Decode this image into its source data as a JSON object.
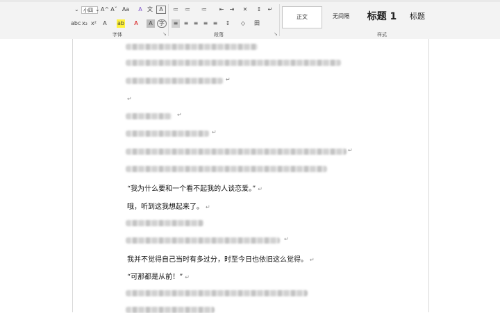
{
  "ribbon": {
    "font_size_value": "小四",
    "groups": {
      "font": "字体",
      "paragraph": "段落",
      "styles": "样式"
    },
    "style_gallery": [
      "正文",
      "无间隔",
      "标题 1",
      "标题"
    ],
    "symbols": {
      "grow_font": "A^",
      "shrink_font": "Aˇ",
      "change_case": "Aa",
      "clear_format": "A",
      "phonetic": "文",
      "char_border": "A",
      "strike": "abc",
      "subscript": "x₂",
      "superscript": "x²",
      "text_effects": "A",
      "highlight": "ab",
      "font_color": "A",
      "char_shading": "A",
      "enclosed": "字",
      "bullets": "≔",
      "numbering": "≔",
      "multilevel": "≔",
      "decrease_indent": "⇤",
      "increase_indent": "⇥",
      "sort": "↕",
      "show_marks": "↵",
      "asian_layout": "✕",
      "align_left": "≡",
      "center": "≡",
      "align_right": "≡",
      "justify": "≡",
      "distributed": "≡",
      "line_spacing": "↕",
      "shading": "◇",
      "borders": "田",
      "dialog_launcher": "↘"
    }
  },
  "document": {
    "paragraph_mark": "↵",
    "lines": [
      "“我为什么要和一个看不起我的人谈恋爱。”",
      "哦，听到这我想起来了。",
      "我并不觉得自己当时有多过分，时至今日也依旧这么觉得。",
      "“可那都是从前！”"
    ]
  }
}
